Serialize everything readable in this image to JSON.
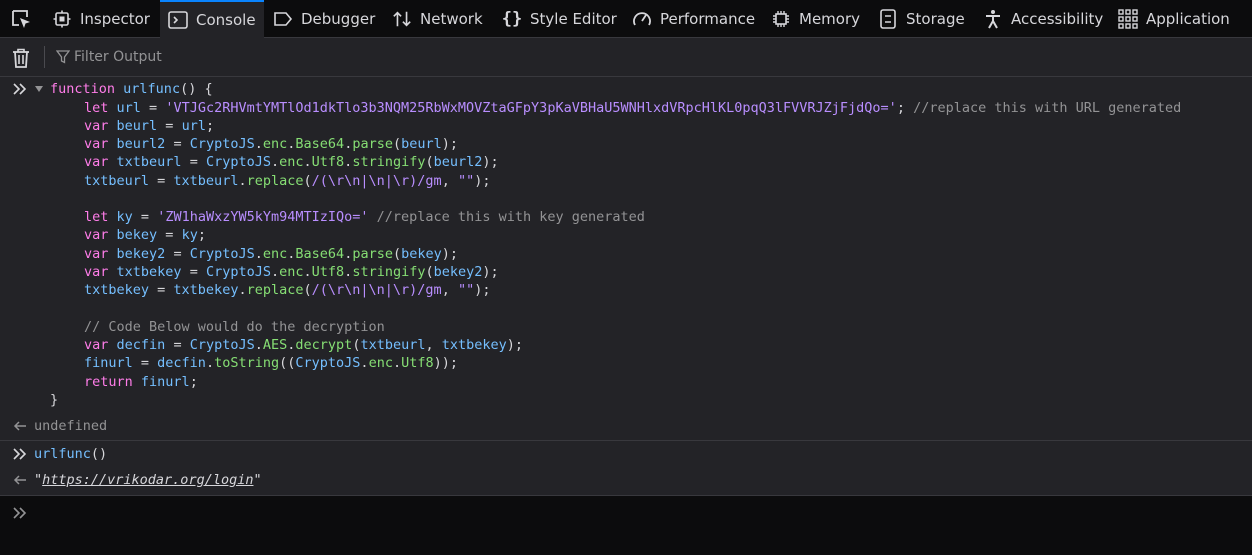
{
  "toolbar": {
    "tabs": [
      {
        "label": "Inspector",
        "icon": "inspector-icon"
      },
      {
        "label": "Console",
        "icon": "console-icon",
        "selected": true
      },
      {
        "label": "Debugger",
        "icon": "debugger-icon"
      },
      {
        "label": "Network",
        "icon": "network-icon"
      },
      {
        "label": "Style Editor",
        "icon": "style-editor-icon"
      },
      {
        "label": "Performance",
        "icon": "performance-icon"
      },
      {
        "label": "Memory",
        "icon": "memory-icon"
      },
      {
        "label": "Storage",
        "icon": "storage-icon"
      },
      {
        "label": "Accessibility",
        "icon": "accessibility-icon"
      },
      {
        "label": "Application",
        "icon": "application-icon"
      }
    ]
  },
  "filter": {
    "placeholder": "Filter Output"
  },
  "console": {
    "entry1": {
      "code": {
        "l1_kw": "function",
        "l1_name": "urlfunc",
        "l1_rest": "() {",
        "l2_kw": "let",
        "l2_id": "url",
        "l2_eq": " = ",
        "l2_str": "'VTJGc2RHVmtYMTlOd1dkTlo3b3NQM25RbWxMOVZtaGFpY3pKaVBHaU5WNHlxdVRpcHlKL0pqQ3lFVVRJZjFjdQo='",
        "l2_semi": "; ",
        "l2_cm": "//replace this with URL generated",
        "l3_kw": "var",
        "l3_id": "beurl",
        "l3_eq": " = ",
        "l3_ref": "url",
        "l3_semi": ";",
        "l4_kw": "var",
        "l4_id": "beurl2",
        "l4_eq": " = ",
        "l4_o1": "CryptoJS",
        "l4_p1": "enc",
        "l4_p2": "Base64",
        "l4_p3": "parse",
        "l4_arg": "beurl",
        "l4_end": ");",
        "l5_kw": "var",
        "l5_id": "txtbeurl",
        "l5_eq": " = ",
        "l5_o1": "CryptoJS",
        "l5_p1": "enc",
        "l5_p2": "Utf8",
        "l5_p3": "stringify",
        "l5_arg": "beurl2",
        "l5_end": ");",
        "l6_id": "txtbeurl",
        "l6_eq": " = ",
        "l6_o1": "txtbeurl",
        "l6_p1": "replace",
        "l6_rx": "/(\\r\\n|\\n|\\r)/gm",
        "l6_comma": ", ",
        "l6_str": "\"\"",
        "l6_end": ");",
        "l8_kw": "let",
        "l8_id": "ky",
        "l8_eq": " = ",
        "l8_str": "'ZW1haWxzYW5kYm94MTIzIQo='",
        "l8_sp": " ",
        "l8_cm": "//replace this with key generated",
        "l9_kw": "var",
        "l9_id": "bekey",
        "l9_eq": " = ",
        "l9_ref": "ky",
        "l9_semi": ";",
        "l10_kw": "var",
        "l10_id": "bekey2",
        "l10_eq": " = ",
        "l10_o1": "CryptoJS",
        "l10_p1": "enc",
        "l10_p2": "Base64",
        "l10_p3": "parse",
        "l10_arg": "bekey",
        "l10_end": ");",
        "l11_kw": "var",
        "l11_id": "txtbekey",
        "l11_eq": " = ",
        "l11_o1": "CryptoJS",
        "l11_p1": "enc",
        "l11_p2": "Utf8",
        "l11_p3": "stringify",
        "l11_arg": "bekey2",
        "l11_end": ");",
        "l12_id": "txtbekey",
        "l12_eq": " = ",
        "l12_o1": "txtbekey",
        "l12_p1": "replace",
        "l12_rx": "/(\\r\\n|\\n|\\r)/gm",
        "l12_comma": ", ",
        "l12_str": "\"\"",
        "l12_end": ");",
        "l14_cm": "// Code Below would do the decryption",
        "l15_kw": "var",
        "l15_id": "decfin",
        "l15_eq": " = ",
        "l15_o1": "CryptoJS",
        "l15_p1": "AES",
        "l15_p2": "decrypt",
        "l15_a1": "txtbeurl",
        "l15_comma": ", ",
        "l15_a2": "txtbekey",
        "l15_end": ");",
        "l16_id": "finurl",
        "l16_eq": " = ",
        "l16_o1": "decfin",
        "l16_p1": "toString",
        "l16_open": "((",
        "l16_o2": "CryptoJS",
        "l16_p2": "enc",
        "l16_p3": "Utf8",
        "l16_end": "));",
        "l17_kw": "return",
        "l17_ref": "finurl",
        "l17_semi": ";",
        "l18": "}"
      },
      "result": "undefined"
    },
    "entry2": {
      "input_name": "urlfunc",
      "input_parens": "()",
      "result_quote_open": "\"",
      "result_url": "https://vrikodar.org/login",
      "result_quote_close": "\""
    }
  },
  "colors": {
    "accent": "#0a84ff",
    "keyword": "#ff7de9",
    "function": "#75bfff",
    "string": "#b98eff",
    "comment": "#939395",
    "identifier": "#86de74"
  }
}
